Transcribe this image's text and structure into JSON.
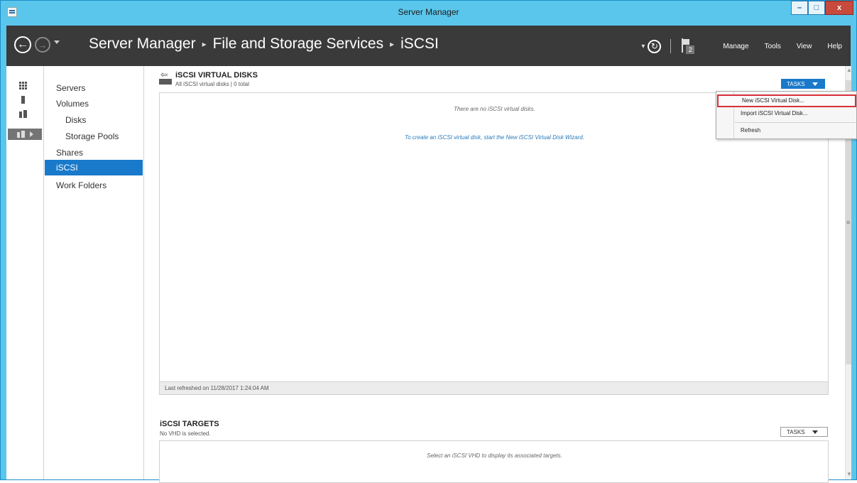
{
  "window": {
    "title": "Server Manager",
    "buttons": {
      "minimize": "–",
      "maximize": "□",
      "close": "x"
    }
  },
  "header": {
    "breadcrumb": [
      "Server Manager",
      "File and Storage Services",
      "iSCSI"
    ],
    "notification_count": "2",
    "menu": [
      "Manage",
      "Tools",
      "View",
      "Help"
    ]
  },
  "icons": {
    "back": "back-arrow-icon",
    "forward": "forward-arrow-icon",
    "refresh": "refresh-icon",
    "flag": "notification-flag-icon"
  },
  "nav": {
    "items": [
      {
        "label": "Servers"
      },
      {
        "label": "Volumes"
      },
      {
        "label": "Disks"
      },
      {
        "label": "Storage Pools"
      },
      {
        "label": "Shares"
      },
      {
        "label": "iSCSI"
      },
      {
        "label": "Work Folders"
      }
    ],
    "selected": "iSCSI"
  },
  "virtual_disks": {
    "title": "iSCSI VIRTUAL DISKS",
    "subtitle": "All iSCSI virtual disks | 0 total",
    "tasks_label": "TASKS",
    "empty_message": "There are no iSCSI virtual disks.",
    "wizard_link": "To create an iSCSI virtual disk, start the New iSCSI Virtual Disk Wizard.",
    "last_refreshed": "Last refreshed on 11/28/2017 1:24:04 AM"
  },
  "targets": {
    "title": "iSCSI TARGETS",
    "subtitle": "No VHD is selected.",
    "tasks_label": "TASKS",
    "empty_message": "Select an iSCSI VHD to display its associated targets."
  },
  "tasks_menu": {
    "items": [
      "New iSCSI Virtual Disk...",
      "Import iSCSI Virtual Disk...",
      "Refresh"
    ],
    "highlighted": "New iSCSI Virtual Disk..."
  },
  "colors": {
    "titlebar": "#5bc6ec",
    "header": "#3a3a3a",
    "accent": "#1979ca",
    "highlight_border": "#d8303a"
  }
}
